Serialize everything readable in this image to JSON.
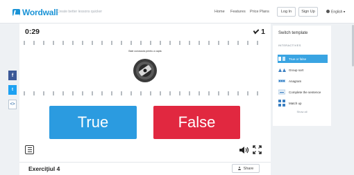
{
  "header": {
    "logo_text": "Wordwall",
    "tagline": "Create better lessons quicker",
    "nav": [
      "Home",
      "Features",
      "Price Plans"
    ],
    "login_label": "Log In",
    "signup_label": "Sign Up",
    "language": "English"
  },
  "share_sidebar": {
    "facebook": "f",
    "twitter": "t",
    "embed": "<>"
  },
  "activity": {
    "timer": "0:29",
    "score": "1",
    "question_text": "Baie cunoscuta pentru a capta",
    "question_image": "rotary-knob-image",
    "answers": [
      {
        "label": "True",
        "color": "#2b9be0"
      },
      {
        "label": "False",
        "color": "#e12840"
      }
    ],
    "title": "Exerciţiul 4",
    "share_label": "Share"
  },
  "template_panel": {
    "title": "Switch template",
    "section": "INTERACTIVES",
    "items": [
      {
        "label": "True or false",
        "icon": "true-false-icon",
        "active": true
      },
      {
        "label": "Group sort",
        "icon": "group-sort-icon",
        "active": false
      },
      {
        "label": "Anagram",
        "icon": "anagram-icon",
        "active": false
      },
      {
        "label": "Complete the sentence",
        "icon": "complete-sentence-icon",
        "active": false
      },
      {
        "label": "Match up",
        "icon": "match-up-icon",
        "active": false
      }
    ],
    "show_all": "Show all"
  },
  "colors": {
    "brand": "#1a93d6",
    "true_button": "#2b9be0",
    "false_button": "#e12840",
    "active_template": "#39a4e2"
  }
}
